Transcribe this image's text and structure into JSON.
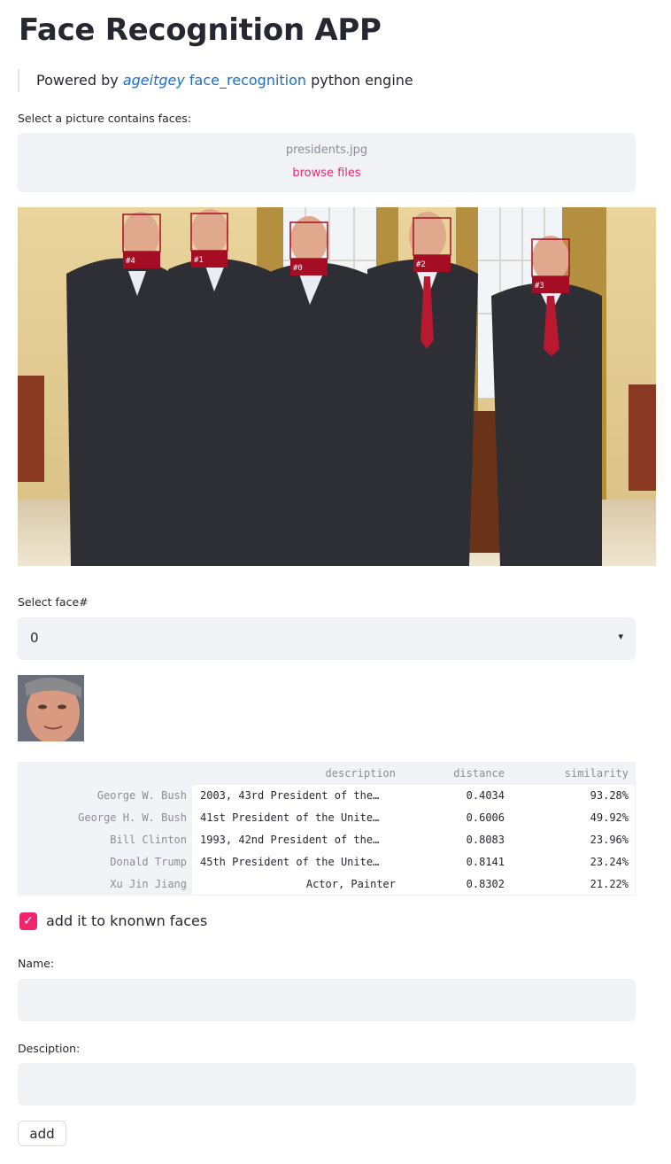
{
  "app": {
    "title": "Face Recognition APP",
    "powered_prefix": "Powered by ",
    "powered_author": "ageitgey",
    "powered_lib": "face_recognition",
    "powered_suffix": " python engine"
  },
  "uploader": {
    "label": "Select a picture contains faces:",
    "filename": "presidents.jpg",
    "browse_label": "browse files"
  },
  "photo": {
    "face_tags": [
      "#4",
      "#1",
      "#0",
      "#2",
      "#3"
    ]
  },
  "face_select": {
    "label": "Select face#",
    "value": "0",
    "caret": "▾"
  },
  "results": {
    "columns": [
      "description",
      "distance",
      "similarity"
    ],
    "rows": [
      {
        "name": "George W. Bush",
        "description": "2003, 43rd President of the…",
        "distance": "0.4034",
        "similarity": "93.28%"
      },
      {
        "name": "George H. W. Bush",
        "description": "41st President of the Unite…",
        "distance": "0.6006",
        "similarity": "49.92%"
      },
      {
        "name": "Bill Clinton",
        "description": "1993, 42nd President of the…",
        "distance": "0.8083",
        "similarity": "23.96%"
      },
      {
        "name": "Donald Trump",
        "description": "45th President of the Unite…",
        "distance": "0.8141",
        "similarity": "23.24%"
      },
      {
        "name": "Xu Jin Jiang",
        "description": "Actor, Painter",
        "distance": "0.8302",
        "similarity": "21.22%"
      }
    ]
  },
  "add_known": {
    "checked": true,
    "check_glyph": "✓",
    "label": "add it to knonwn faces"
  },
  "form": {
    "name_label": "Name:",
    "name_value": "",
    "desc_label": "Desciption:",
    "desc_value": "",
    "add_button": "add"
  }
}
